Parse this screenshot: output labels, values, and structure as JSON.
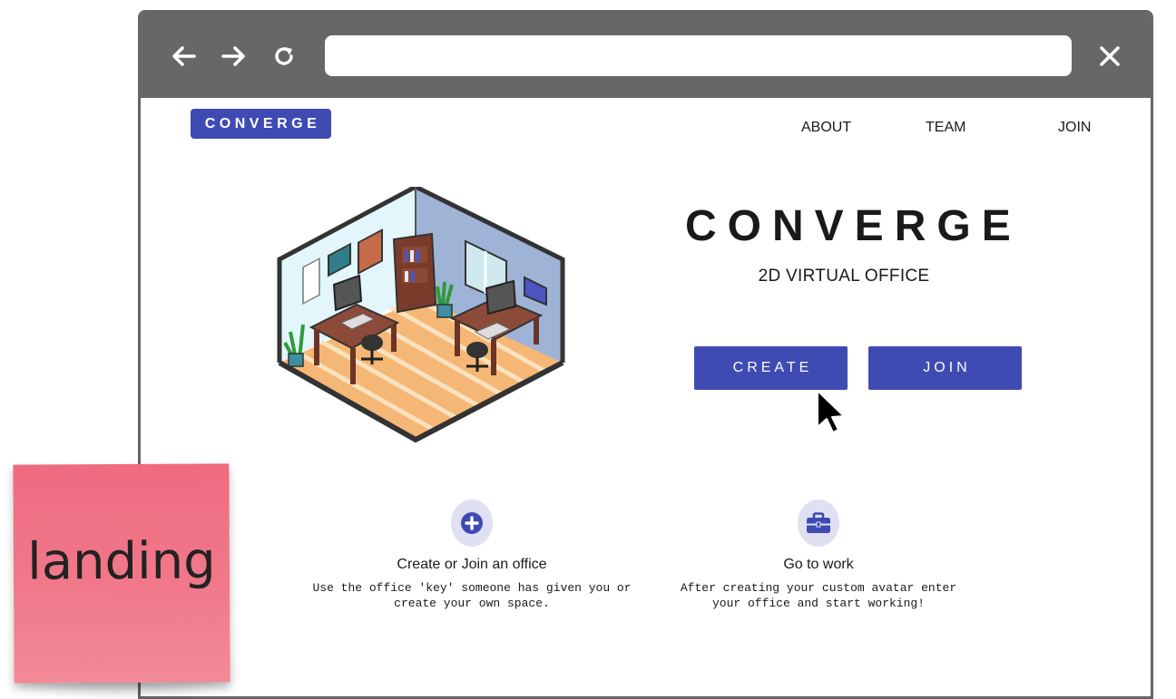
{
  "browser": {
    "back_icon": "arrow-left-icon",
    "forward_icon": "arrow-right-icon",
    "reload_icon": "reload-icon",
    "close_icon": "close-icon",
    "url": ""
  },
  "header": {
    "logo": "CONVERGE",
    "nav": [
      "ABOUT",
      "TEAM",
      "JOIN"
    ]
  },
  "hero": {
    "title": "CONVERGE",
    "subtitle": "2D VIRTUAL OFFICE",
    "create_label": "CREATE",
    "join_label": "JOIN"
  },
  "features": [
    {
      "icon": "plus-circle-icon",
      "title": "Create or Join an office",
      "desc_line1": "Use the office 'key' someone has given you or",
      "desc_line2": "create your own space."
    },
    {
      "icon": "briefcase-icon",
      "title": "Go to work",
      "desc_line1": "After creating your custom avatar enter",
      "desc_line2": "your office and start working!"
    }
  ],
  "sticky_note": {
    "text": "landing"
  },
  "colors": {
    "brand": "#3f4ab3",
    "chrome": "#676767",
    "sticky": "#f0788a",
    "icon_bg": "#dfe1f2"
  }
}
